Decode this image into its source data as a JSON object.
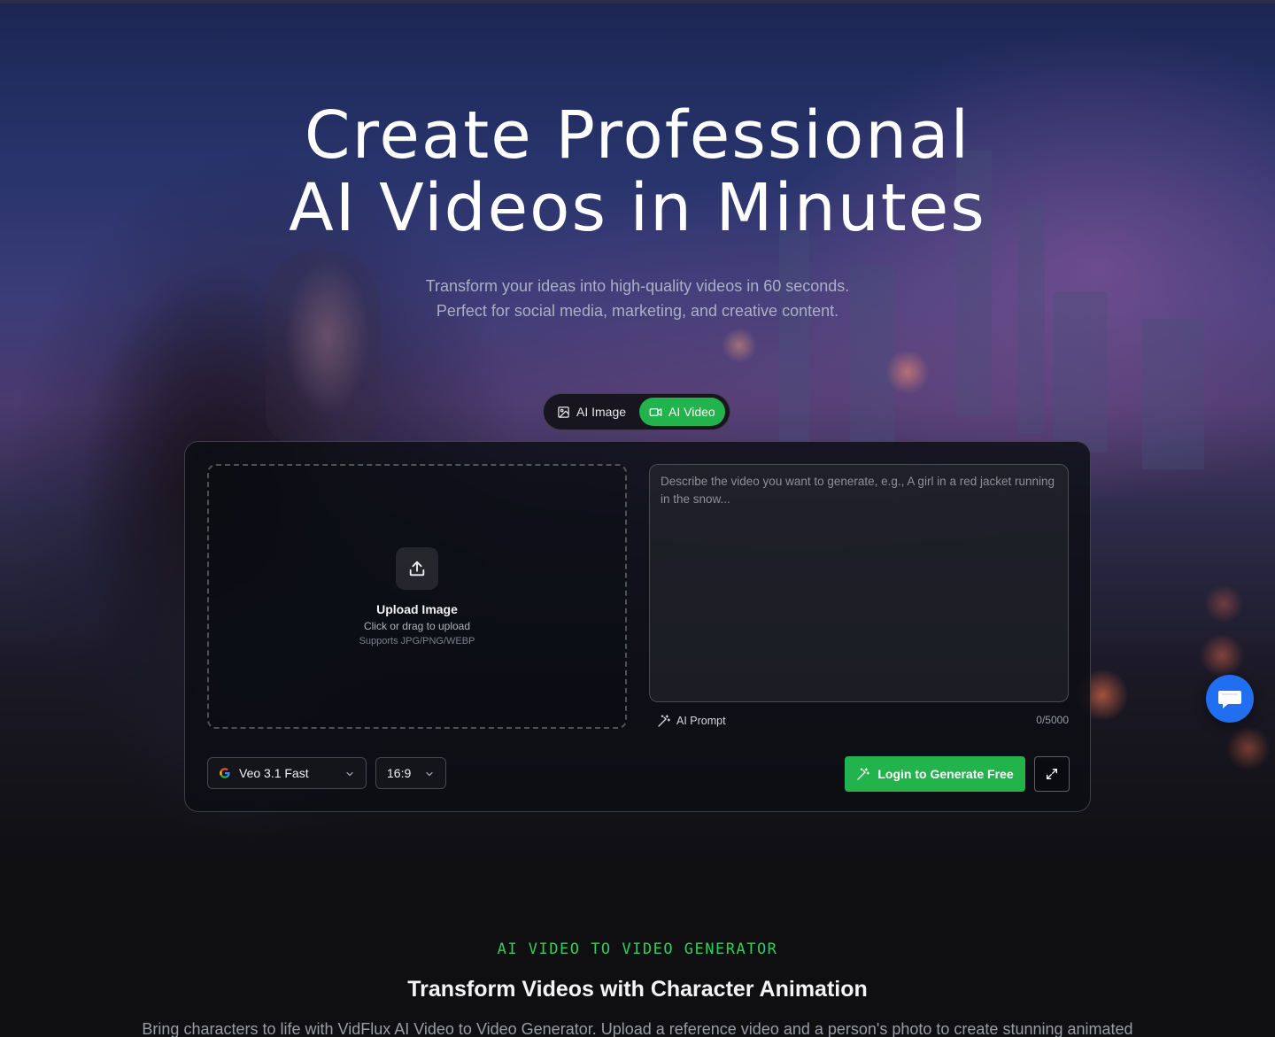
{
  "hero": {
    "title_line1": "Create Professional",
    "title_line2": "AI Videos in Minutes",
    "subtitle_line1": "Transform your ideas into high-quality videos in 60 seconds.",
    "subtitle_line2": "Perfect for social media, marketing, and creative content."
  },
  "mode_switch": {
    "tabs": [
      {
        "label": "AI Image",
        "icon": "image-icon",
        "active": false
      },
      {
        "label": "AI Video",
        "icon": "video-camera-icon",
        "active": true
      }
    ]
  },
  "generator": {
    "upload": {
      "icon": "upload-icon",
      "title": "Upload Image",
      "hint": "Click or drag to upload",
      "formats": "Supports JPG/PNG/WEBP"
    },
    "prompt": {
      "value": "",
      "placeholder": "Describe the video you want to generate, e.g., A girl in a red jacket running in the snow..."
    },
    "ai_prompt_label": "AI Prompt",
    "char_count": "0/5000",
    "model_select": {
      "value": "Veo 3.1 Fast",
      "icon": "google-logo-icon"
    },
    "ratio_select": {
      "value": "16:9"
    },
    "generate_button": "Login to Generate Free",
    "expand_icon": "expand-icon"
  },
  "chat_widget": {
    "icon": "chat-icon"
  },
  "section": {
    "eyebrow": "AI VIDEO TO VIDEO GENERATOR",
    "title": "Transform Videos with Character Animation",
    "description": "Bring characters to life with VidFlux AI Video to Video Generator. Upload a reference video and a person's photo to create stunning animated"
  },
  "colors": {
    "accent_green": "#22b34d",
    "eyebrow_green": "#2fcf5c",
    "chat_blue": "#1f6ff0",
    "page_bg": "#0f0f11"
  }
}
